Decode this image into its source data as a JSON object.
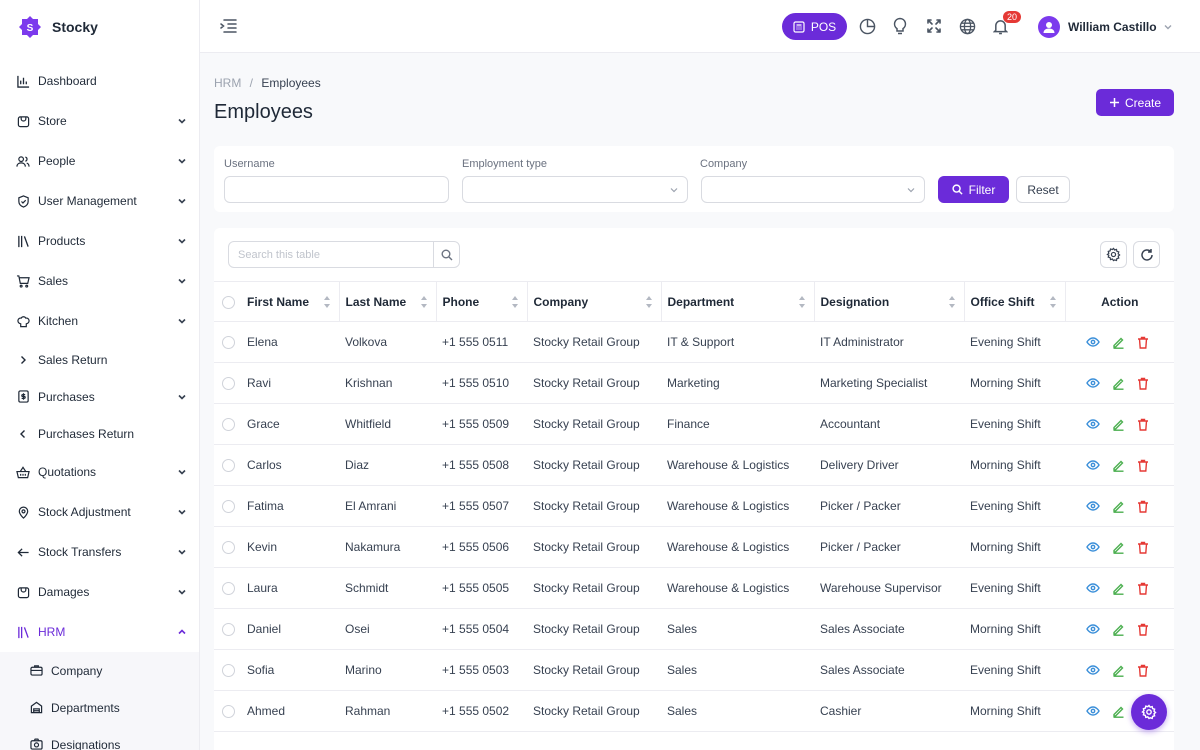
{
  "app": {
    "name": "Stocky"
  },
  "sidebar": {
    "items": [
      {
        "label": "Dashboard",
        "icon": "chart-icon"
      },
      {
        "label": "Store",
        "icon": "store-icon"
      },
      {
        "label": "People",
        "icon": "people-icon"
      },
      {
        "label": "User Management",
        "icon": "shield-icon"
      },
      {
        "label": "Products",
        "icon": "products-icon"
      },
      {
        "label": "Sales",
        "icon": "cart-icon"
      },
      {
        "label": "Kitchen",
        "icon": "chef-icon"
      },
      {
        "label": "Sales Return",
        "icon": "chevron-right-icon"
      },
      {
        "label": "Purchases",
        "icon": "receipt-icon"
      },
      {
        "label": "Purchases Return",
        "icon": "chevron-left-icon"
      },
      {
        "label": "Quotations",
        "icon": "basket-icon"
      },
      {
        "label": "Stock Adjustment",
        "icon": "location-icon"
      },
      {
        "label": "Stock Transfers",
        "icon": "arrow-left-icon"
      },
      {
        "label": "Damages",
        "icon": "box-icon"
      },
      {
        "label": "HRM",
        "icon": "library-icon"
      }
    ],
    "hrm_sub": [
      {
        "label": "Company",
        "icon": "briefcase-icon"
      },
      {
        "label": "Departments",
        "icon": "building-icon"
      },
      {
        "label": "Designations",
        "icon": "camera-icon"
      }
    ]
  },
  "topbar": {
    "pos_label": "POS",
    "notification_count": "20",
    "user_name": "William Castillo"
  },
  "breadcrumb": {
    "parent": "HRM",
    "separator": "/",
    "current": "Employees"
  },
  "page": {
    "title": "Employees",
    "create_label": "Create"
  },
  "filters": {
    "username_label": "Username",
    "username_value": "",
    "employment_type_label": "Employment type",
    "employment_type_value": "",
    "company_label": "Company",
    "company_value": "",
    "filter_label": "Filter",
    "reset_label": "Reset"
  },
  "table": {
    "search_placeholder": "Search this table",
    "columns": [
      "First Name",
      "Last Name",
      "Phone",
      "Company",
      "Department",
      "Designation",
      "Office Shift",
      "Action"
    ],
    "rows": [
      [
        "Elena",
        "Volkova",
        "+1 555 0511",
        "Stocky Retail Group",
        "IT & Support",
        "IT Administrator",
        "Evening Shift"
      ],
      [
        "Ravi",
        "Krishnan",
        "+1 555 0510",
        "Stocky Retail Group",
        "Marketing",
        "Marketing Specialist",
        "Morning Shift"
      ],
      [
        "Grace",
        "Whitfield",
        "+1 555 0509",
        "Stocky Retail Group",
        "Finance",
        "Accountant",
        "Evening Shift"
      ],
      [
        "Carlos",
        "Diaz",
        "+1 555 0508",
        "Stocky Retail Group",
        "Warehouse & Logistics",
        "Delivery Driver",
        "Morning Shift"
      ],
      [
        "Fatima",
        "El Amrani",
        "+1 555 0507",
        "Stocky Retail Group",
        "Warehouse & Logistics",
        "Picker / Packer",
        "Evening Shift"
      ],
      [
        "Kevin",
        "Nakamura",
        "+1 555 0506",
        "Stocky Retail Group",
        "Warehouse & Logistics",
        "Picker / Packer",
        "Morning Shift"
      ],
      [
        "Laura",
        "Schmidt",
        "+1 555 0505",
        "Stocky Retail Group",
        "Warehouse & Logistics",
        "Warehouse Supervisor",
        "Evening Shift"
      ],
      [
        "Daniel",
        "Osei",
        "+1 555 0504",
        "Stocky Retail Group",
        "Sales",
        "Sales Associate",
        "Morning Shift"
      ],
      [
        "Sofia",
        "Marino",
        "+1 555 0503",
        "Stocky Retail Group",
        "Sales",
        "Sales Associate",
        "Evening Shift"
      ],
      [
        "Ahmed",
        "Rahman",
        "+1 555 0502",
        "Stocky Retail Group",
        "Sales",
        "Cashier",
        "Morning Shift"
      ]
    ]
  },
  "colors": {
    "accent": "#6b2bd9",
    "view_icon": "#3b8fd9",
    "edit_icon": "#4caf50",
    "delete_icon": "#e53935"
  }
}
